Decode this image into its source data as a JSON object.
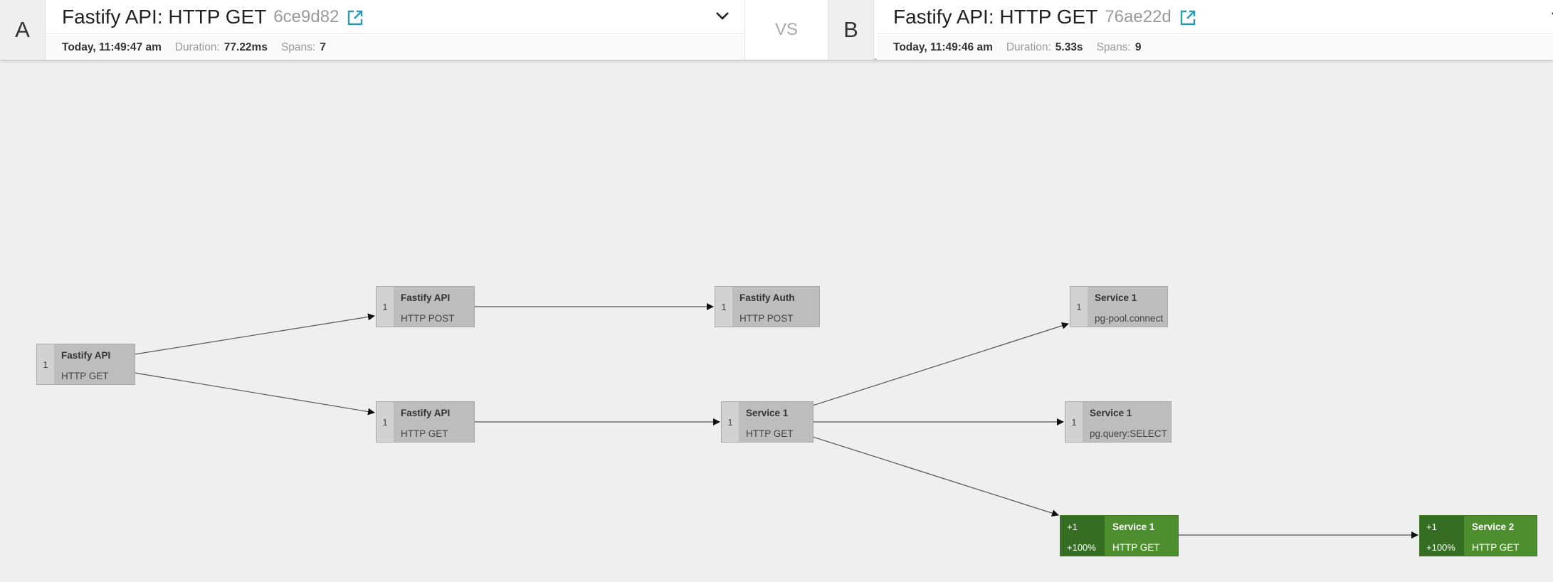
{
  "trace_a": {
    "letter": "A",
    "title": "Fastify API: HTTP GET",
    "id": "6ce9d82",
    "timestamp": "Today, 11:49:47 am",
    "duration_label": "Duration:",
    "duration": "77.22ms",
    "spans_label": "Spans:",
    "spans": "7"
  },
  "vs_label": "VS",
  "trace_b": {
    "letter": "B",
    "title": "Fastify API: HTTP GET",
    "id": "76ae22d",
    "timestamp": "Today, 11:49:46 am",
    "duration_label": "Duration:",
    "duration": "5.33s",
    "spans_label": "Spans:",
    "spans": "9"
  },
  "colors": {
    "accent_link": "#2a9ab2",
    "node_default": "#bdbdbd",
    "node_added": "#4d8f2e",
    "node_added_count": "#356d22"
  },
  "icons": {
    "external_link": "external-link-icon",
    "dropdown": "chevron-down-icon"
  },
  "graph": {
    "nodes": [
      {
        "count": "1",
        "service": "Fastify API",
        "operation": "HTTP GET"
      },
      {
        "count": "1",
        "service": "Fastify API",
        "operation": "HTTP POST"
      },
      {
        "count": "1",
        "service": "Fastify API",
        "operation": "HTTP GET"
      },
      {
        "count": "1",
        "service": "Fastify Auth",
        "operation": "HTTP POST"
      },
      {
        "count": "1",
        "service": "Service 1",
        "operation": "HTTP GET"
      },
      {
        "count": "1",
        "service": "Service 1",
        "operation": "pg-pool.connect"
      },
      {
        "count": "1",
        "service": "Service 1",
        "operation": "pg.query:SELECT"
      },
      {
        "count": "+1",
        "delta_pct": "+100%",
        "service": "Service 1",
        "operation": "HTTP GET",
        "status": "added"
      },
      {
        "count": "+1",
        "delta_pct": "+100%",
        "service": "Service 2",
        "operation": "HTTP GET",
        "status": "added"
      }
    ]
  }
}
